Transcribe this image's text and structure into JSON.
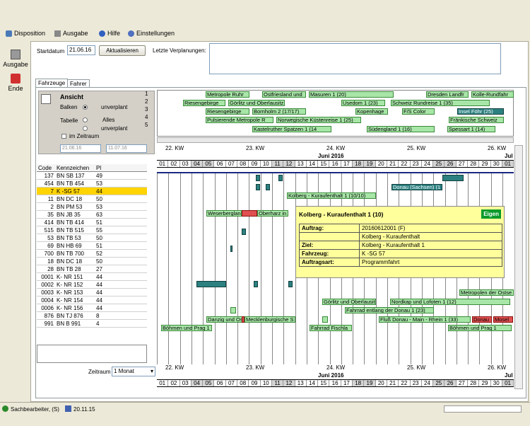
{
  "menu": {
    "disposition": "Disposition",
    "ausgabe": "Ausgabe",
    "hilfe": "Hilfe",
    "einstellungen": "Einstellungen"
  },
  "left": {
    "ausgabe": "Ausgabe",
    "ende": "Ende"
  },
  "top": {
    "startdatum_label": "Startdatum",
    "startdatum": "21.06.16",
    "aktualisieren": "Aktualisieren",
    "letzte": "Letzte Verplanungen:"
  },
  "tabs": {
    "fahrzeuge": "Fahrzeuge",
    "fahrer": "Fahrer"
  },
  "ansicht": {
    "title": "Ansicht",
    "balken": "Balken",
    "unverplant": "unverplant",
    "tabelle": "Tabelle",
    "alles": "Alles",
    "unverplant2": "unverplant",
    "zeitraum": "im Zeitraum",
    "from": "21.06.16",
    "to": "11.07.16"
  },
  "columns": {
    "code": "Code",
    "kennzeichen": "Kennzeichen",
    "pl": "Pl"
  },
  "vehicles": [
    {
      "code": "137",
      "kz": "BN SB 137",
      "pl": "49"
    },
    {
      "code": "454",
      "kz": "BN TB 454",
      "pl": "53"
    },
    {
      "code": "7",
      "kz": "K -SG 57",
      "pl": "44"
    },
    {
      "code": "11",
      "kz": "BN DC 18",
      "pl": "50"
    },
    {
      "code": "2",
      "kz": "BN PM 53",
      "pl": "53"
    },
    {
      "code": "35",
      "kz": "BN JB 35",
      "pl": "63"
    },
    {
      "code": "414",
      "kz": "BN TB 414",
      "pl": "51"
    },
    {
      "code": "515",
      "kz": "BN TB 515",
      "pl": "55"
    },
    {
      "code": "53",
      "kz": "BN TB 53",
      "pl": "50"
    },
    {
      "code": "69",
      "kz": "BN HB 69",
      "pl": "51"
    },
    {
      "code": "700",
      "kz": "BN TB 700",
      "pl": "52"
    },
    {
      "code": "18",
      "kz": "BN DC 18",
      "pl": "50"
    },
    {
      "code": "28",
      "kz": "BN TB 28",
      "pl": "27"
    },
    {
      "code": "0001",
      "kz": "K- NR 151",
      "pl": "44"
    },
    {
      "code": "0002",
      "kz": "K- NR 152",
      "pl": "44"
    },
    {
      "code": "0003",
      "kz": "K- NR 153",
      "pl": "44"
    },
    {
      "code": "0004",
      "kz": "K- NR 154",
      "pl": "44"
    },
    {
      "code": "0006",
      "kz": "K- NR 156",
      "pl": "44"
    },
    {
      "code": "876",
      "kz": "BN TJ 876",
      "pl": "8"
    },
    {
      "code": "991",
      "kz": "BN B 991",
      "pl": "4"
    }
  ],
  "zeitraum_label": "Zeitraum",
  "zeitraum": "1 Monat",
  "kws": [
    "22. KW",
    "23. KW",
    "24. KW",
    "25. KW",
    "26. KW"
  ],
  "month": "Juni 2016",
  "month2": "Jul",
  "days": [
    "01",
    "02",
    "03",
    "04",
    "05",
    "06",
    "07",
    "08",
    "09",
    "10",
    "11",
    "12",
    "13",
    "14",
    "15",
    "16",
    "17",
    "18",
    "19",
    "20",
    "21",
    "22",
    "23",
    "24",
    "25",
    "26",
    "27",
    "28",
    "29",
    "30",
    "01"
  ],
  "rownums": [
    "1",
    "2",
    "3",
    "4",
    "5"
  ],
  "topbars": [
    "Metropole Ruhr",
    "Ostfriesland und",
    "Masuren 1 (20)",
    "Dresden Landfr",
    "Kolle-Rundfahr",
    "Riesengebirge",
    "Görlitz und Oberlausitz",
    "Usedom 1 (23)",
    "Schweiz Rundreise 1 (35)",
    "Riesengebirge",
    "Bornholm 2 (17/17)",
    "Kopenhage",
    "F/S Color",
    "Insel Föhr (25)",
    "Pulsierende Metropole R",
    "Norwegische Küstenreise 1 (25)",
    "Fränkische Schweiz",
    "Kastelruther Spatzen 1 (14",
    "Südengland 1 (16)",
    "Spessart 1 (14)"
  ],
  "bars": [
    "Kolberg - Kuraufenthalt 1 (10/10)",
    "Donau (Sachsen) (1",
    "Weserbergland",
    "Oberharz in Masu",
    "Görlitz und Oberlausit",
    "Nordkap und Lofoten 1 (12)",
    "Metropolen der Ostse",
    "Fahrrad entlang der Donau 1 (23)",
    "Danzig und Ostse",
    "Mecklenburgische S",
    "Fluß Donau - Main - Rhein 1 (33)",
    "Donau",
    "Mosel",
    "Böhmen und Prag 1",
    "Fahrrad Fischla",
    "Böhmen und Prag 1",
    "Insel Föhr"
  ],
  "tooltip": {
    "title": "Kolberg - Kuraufenthalt 1 (10)",
    "badge": "Eigen",
    "auftrag_l": "Auftrag:",
    "auftrag": "20160612001 (F)",
    "auftrag2": "Kolberg - Kuraufenthalt",
    "ziel_l": "Ziel:",
    "ziel": "Kolberg - Kuraufenthalt 1",
    "fahrzeug_l": "Fahrzeug:",
    "fahrzeug": "K -SG 57",
    "art_l": "Auftragsart:",
    "art": "Programmfahrt"
  },
  "status": {
    "user": "Sachbearbeiter, (S)",
    "date": "20.11.15"
  }
}
